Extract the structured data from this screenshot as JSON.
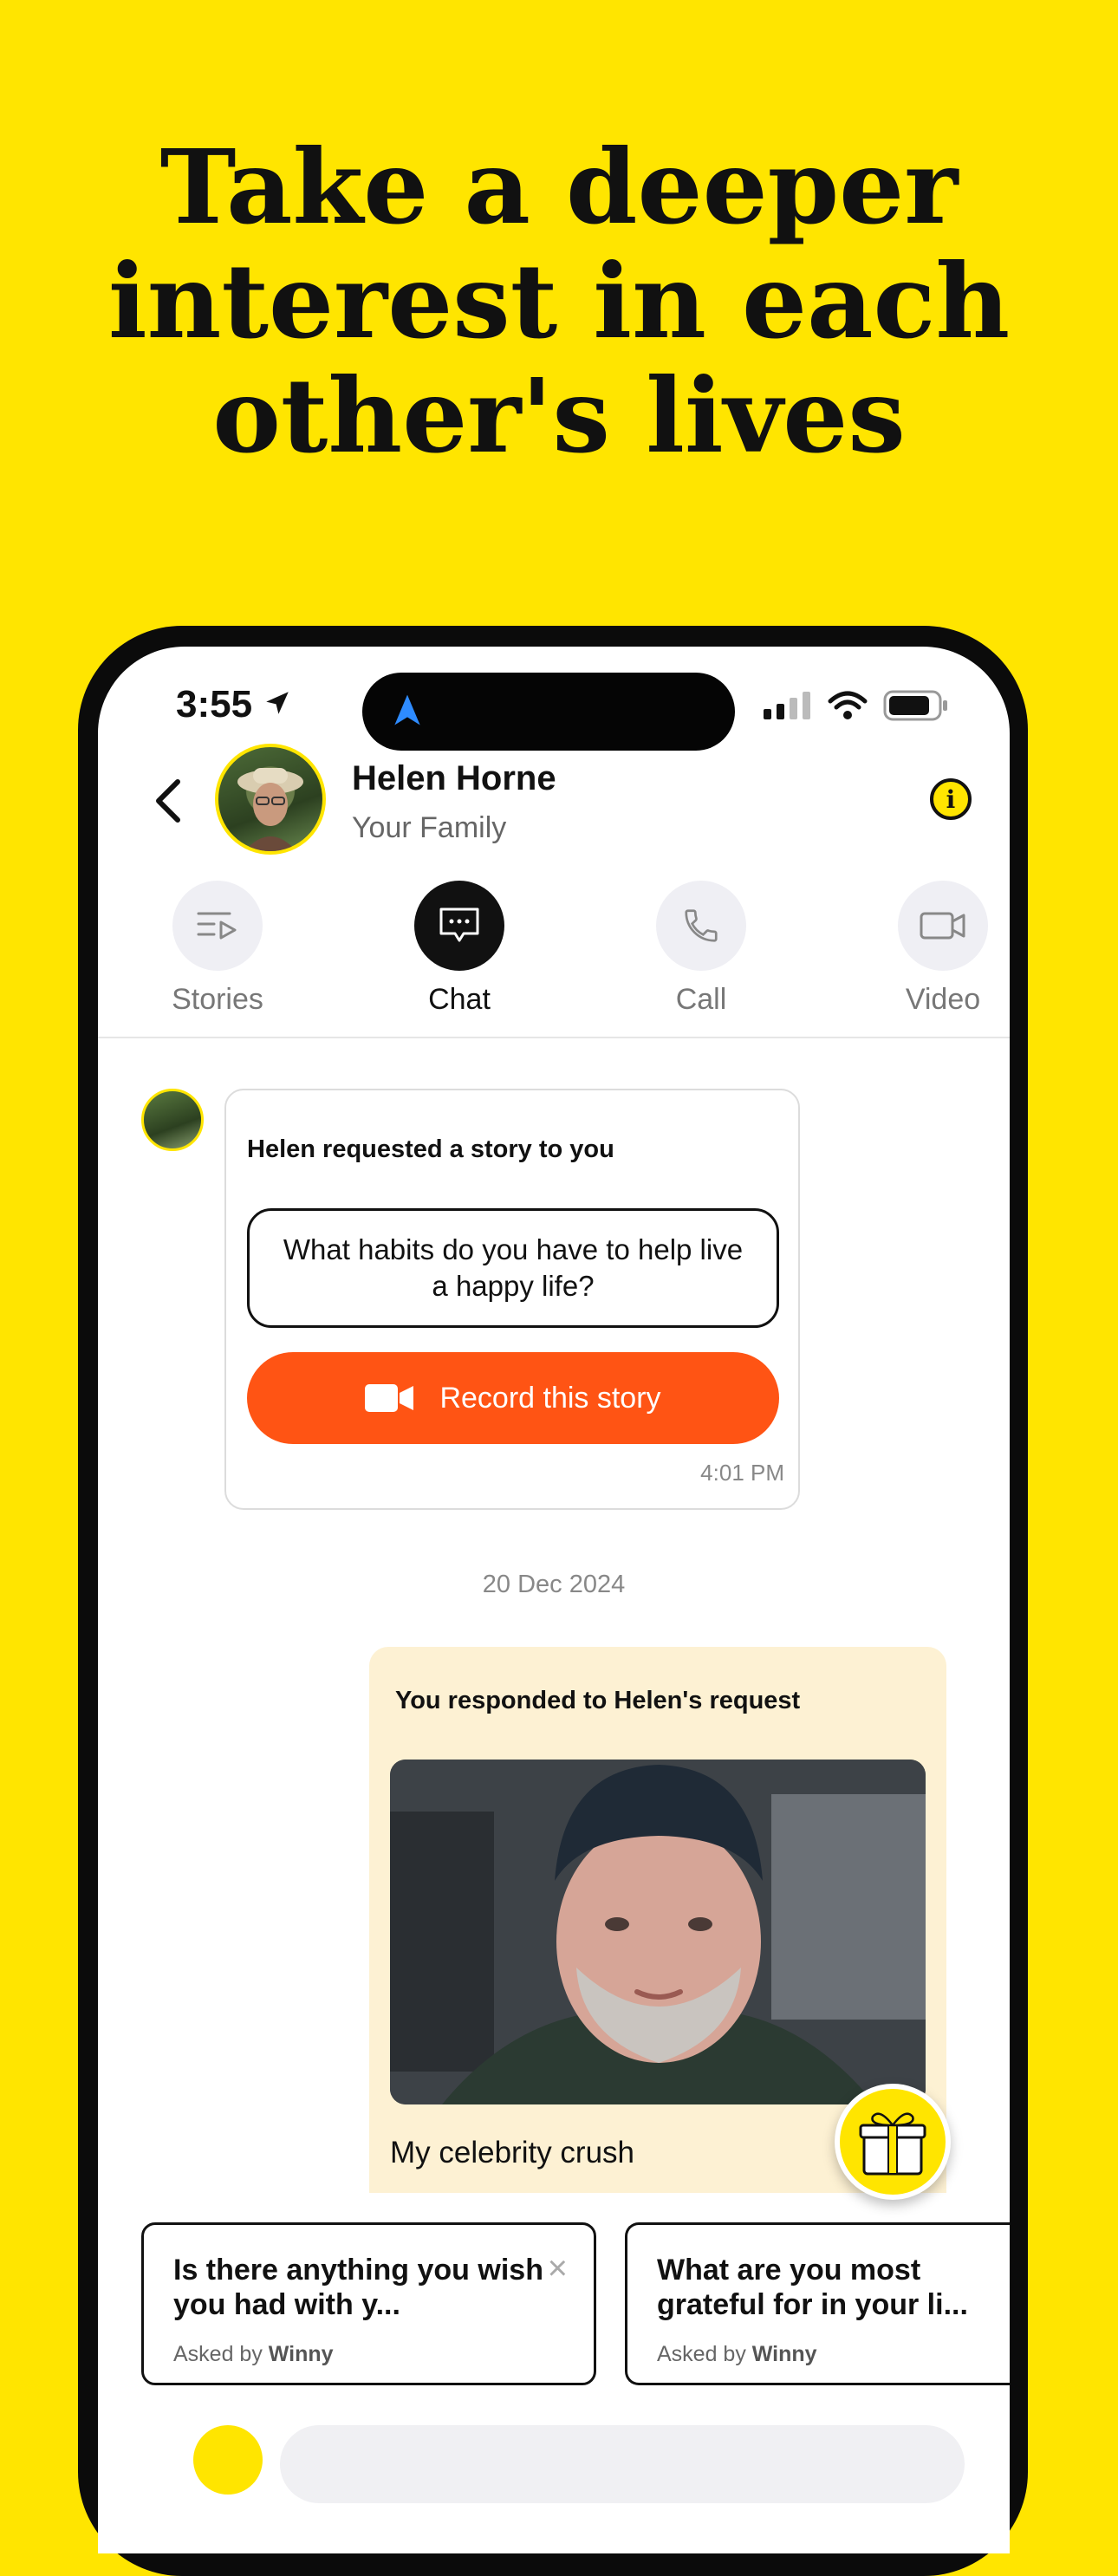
{
  "headline": [
    "Take a deeper",
    "interest in each",
    "other's lives"
  ],
  "status_bar": {
    "time": "3:55"
  },
  "contact": {
    "name": "Helen Horne",
    "subtitle": "Your Family"
  },
  "tabs": [
    {
      "label": "Stories",
      "icon": "stories-icon",
      "active": false
    },
    {
      "label": "Chat",
      "icon": "chat-icon",
      "active": true
    },
    {
      "label": "Call",
      "icon": "phone-icon",
      "active": false
    },
    {
      "label": "Video",
      "icon": "video-icon",
      "active": false
    }
  ],
  "request": {
    "title": "Helen requested a story to you",
    "question": "What habits do you have to help live a happy life?",
    "button": "Record this story",
    "time": "4:01 PM"
  },
  "date_separator": "20 Dec 2024",
  "response": {
    "title": "You responded to Helen's request",
    "caption": "My celebrity crush"
  },
  "suggestions": [
    {
      "question": "Is there anything you wish you had with y...",
      "asked_prefix": "Asked by",
      "asked_by": "Winny"
    },
    {
      "question": "What are you most grateful for in your li...",
      "asked_prefix": "Asked by",
      "asked_by": "Winny"
    }
  ],
  "colors": {
    "brand_yellow": "#FFE500",
    "record_orange": "#FF5414",
    "response_bg": "#FDF1D3"
  }
}
